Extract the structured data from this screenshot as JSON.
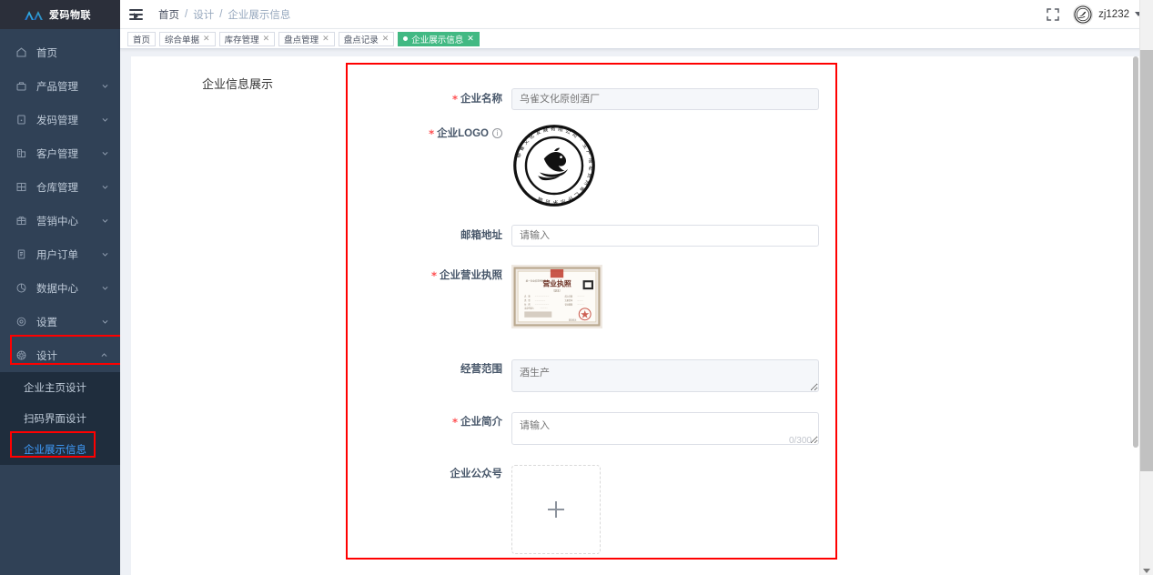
{
  "brand": {
    "name": "爱码物联",
    "logo_icon": "app-logo-icon"
  },
  "sidebar": {
    "items": [
      {
        "label": "首页",
        "icon": "home-icon",
        "expandable": false
      },
      {
        "label": "产品管理",
        "icon": "bag-icon",
        "expandable": true
      },
      {
        "label": "发码管理",
        "icon": "document-icon",
        "expandable": true
      },
      {
        "label": "客户管理",
        "icon": "building-icon",
        "expandable": true
      },
      {
        "label": "仓库管理",
        "icon": "grid-icon",
        "expandable": true
      },
      {
        "label": "营销中心",
        "icon": "gift-icon",
        "expandable": true
      },
      {
        "label": "用户订单",
        "icon": "list-icon",
        "expandable": true
      },
      {
        "label": "数据中心",
        "icon": "pie-icon",
        "expandable": true
      },
      {
        "label": "设置",
        "icon": "gear-icon",
        "expandable": true
      },
      {
        "label": "设计",
        "icon": "compass-icon",
        "expandable": true,
        "open": true
      }
    ],
    "design_submenu": [
      {
        "label": "企业主页设计",
        "active": false
      },
      {
        "label": "扫码界面设计",
        "active": false
      },
      {
        "label": "企业展示信息",
        "active": true
      }
    ]
  },
  "navbar": {
    "hamburger_icon": "hamburger-icon",
    "breadcrumb": [
      "首页",
      "设计",
      "企业展示信息"
    ],
    "breadcrumb_separator": "/",
    "fullscreen_icon": "fullscreen-icon",
    "username": "zj1232",
    "caret_icon": "chevron-down-icon"
  },
  "tabs": [
    {
      "label": "首页",
      "active": false,
      "closable": false
    },
    {
      "label": "综合单据",
      "active": false,
      "closable": true
    },
    {
      "label": "库存管理",
      "active": false,
      "closable": true
    },
    {
      "label": "盘点管理",
      "active": false,
      "closable": true
    },
    {
      "label": "盘点记录",
      "active": false,
      "closable": true
    },
    {
      "label": "企业展示信息",
      "active": true,
      "closable": true
    }
  ],
  "main": {
    "page_title": "企业信息展示",
    "form": {
      "fields": [
        {
          "label": "企业名称",
          "required": true,
          "type": "input",
          "value": "",
          "placeholder": "乌雀文化原创酒厂",
          "info": false
        },
        {
          "label": "企业LOGO",
          "required": true,
          "type": "image",
          "info": true,
          "image_name": "company-logo-stamp"
        },
        {
          "label": "邮箱地址",
          "required": false,
          "type": "input",
          "value": "",
          "placeholder": "请输入",
          "info": false
        },
        {
          "label": "企业营业执照",
          "required": true,
          "type": "image",
          "info": false,
          "image_name": "business-license-photo"
        },
        {
          "label": "经营范围",
          "required": false,
          "type": "textarea",
          "value": "",
          "placeholder": "酒生产",
          "info": false
        },
        {
          "label": "企业简介",
          "required": true,
          "type": "textarea",
          "value": "",
          "placeholder": "请输入",
          "counter": "0/300",
          "info": false
        },
        {
          "label": "企业公众号",
          "required": false,
          "type": "upload",
          "info": false,
          "upload_icon": "plus-icon"
        }
      ]
    }
  },
  "colors": {
    "sidebar_bg": "#304156",
    "submenu_bg": "#1f2d3d",
    "brand_bg": "#2b2f3a",
    "active_blue": "#409eff",
    "tab_active_green": "#42b983",
    "annotation_red": "#ff0000",
    "page_bg": "#eef1f6",
    "required_red": "#ff4d4f"
  }
}
